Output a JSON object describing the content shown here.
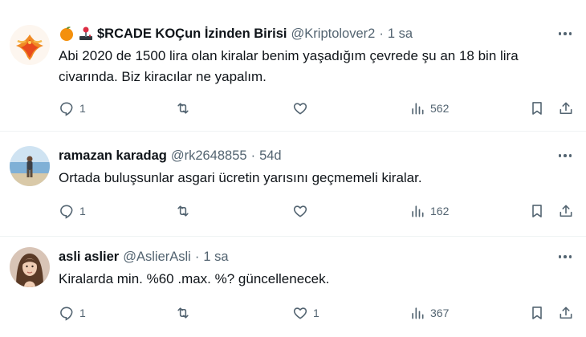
{
  "tweets": [
    {
      "display_name": "$RCADE KOÇun İzinden Birisi",
      "handle": "@Kriptolover2",
      "separator": "·",
      "time": "1 sa",
      "text": "Abi 2020 de 1500 lira olan kiralar benim yaşadığım çevrede şu an 18 bin lira civarında. Biz kiracılar ne yapalım.",
      "replies": "1",
      "retweets": "",
      "likes": "",
      "views": "562",
      "name_emojis": [
        "orange-emoji",
        "joystick-emoji"
      ],
      "avatar": "phoenix-avatar"
    },
    {
      "display_name": "ramazan karadag",
      "handle": "@rk2648855",
      "separator": "·",
      "time": "54d",
      "text": "Ortada buluşsunlar asgari ücretin yarısını geçmemeli kiralar.",
      "replies": "1",
      "retweets": "",
      "likes": "",
      "views": "162",
      "avatar": "beach-avatar"
    },
    {
      "display_name": "asli aslier",
      "handle": "@AslierAsli",
      "separator": "·",
      "time": "1 sa",
      "text": "Kiralarda min. %60 .max. %? güncellenecek.",
      "replies": "1",
      "retweets": "",
      "likes": "1",
      "views": "367",
      "avatar": "woman-portrait-avatar"
    }
  ],
  "colors": {
    "text_primary": "#0f1419",
    "text_secondary": "#536471",
    "divider": "#eff3f4",
    "background": "#ffffff"
  }
}
